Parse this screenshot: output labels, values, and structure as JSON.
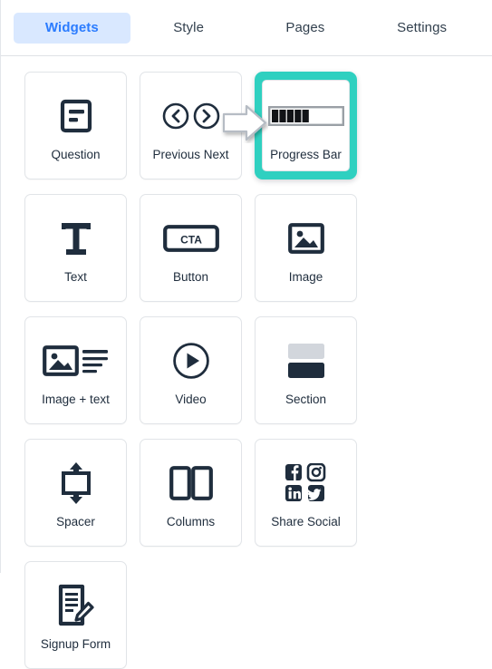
{
  "tabs": [
    {
      "label": "Widgets",
      "active": true
    },
    {
      "label": "Style",
      "active": false
    },
    {
      "label": "Pages",
      "active": false
    },
    {
      "label": "Settings",
      "active": false
    }
  ],
  "colors": {
    "accent_selected": "#2fd0c0",
    "tab_active_bg": "#d9e8ff",
    "tab_active_text": "#2b7cff",
    "label_text": "#1f2d3d",
    "card_border": "#e1e4e8"
  },
  "widgets": [
    {
      "label": "Question",
      "icon": "question-icon",
      "selected": false
    },
    {
      "label": "Previous Next",
      "icon": "previous-next-icon",
      "selected": false
    },
    {
      "label": "Progress Bar",
      "icon": "progress-bar-icon",
      "selected": true
    },
    {
      "label": "Text",
      "icon": "text-icon",
      "selected": false
    },
    {
      "label": "Button",
      "icon": "button-cta-icon",
      "selected": false
    },
    {
      "label": "Image",
      "icon": "image-icon",
      "selected": false
    },
    {
      "label": "Image + text",
      "icon": "image-text-icon",
      "selected": false
    },
    {
      "label": "Video",
      "icon": "video-play-icon",
      "selected": false
    },
    {
      "label": "Section",
      "icon": "section-icon",
      "selected": false
    },
    {
      "label": "Spacer",
      "icon": "spacer-icon",
      "selected": false
    },
    {
      "label": "Columns",
      "icon": "columns-icon",
      "selected": false
    },
    {
      "label": "Share Social",
      "icon": "share-social-icon",
      "selected": false
    },
    {
      "label": "Signup Form",
      "icon": "signup-form-icon",
      "selected": false
    }
  ],
  "button_icon_text": "CTA",
  "progress_bar": {
    "filled_blocks": 5,
    "total_blocks": 10
  },
  "cursor": {
    "type": "arrow-pointer-right"
  }
}
